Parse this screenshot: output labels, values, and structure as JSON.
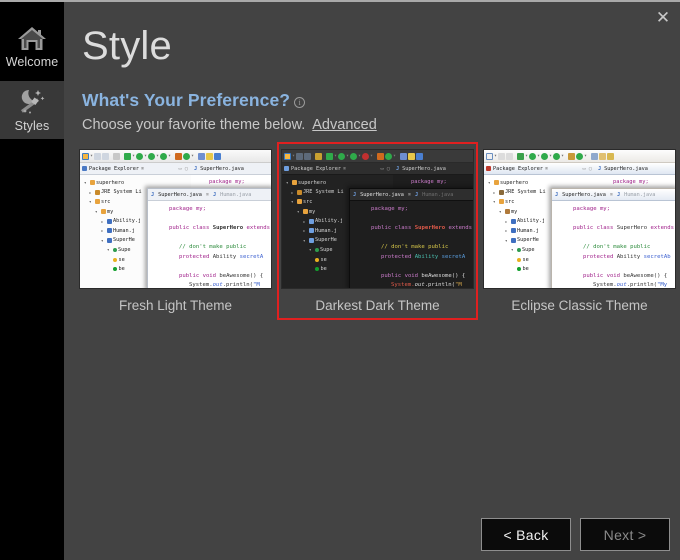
{
  "window": {
    "close_label": "✕"
  },
  "sidebar": {
    "items": [
      {
        "label": "Welcome",
        "icon": "home-icon",
        "selected": false
      },
      {
        "label": "Styles",
        "icon": "magic-wand-icon",
        "selected": true
      }
    ]
  },
  "header": {
    "title": "Style",
    "subheading": "What's Your Preference?",
    "info_icon": "i",
    "description": "Choose your favorite theme below.",
    "advanced_link": "Advanced"
  },
  "themes": {
    "selected_index": 1,
    "selection_color": "#e02020",
    "cards": [
      {
        "label": "Fresh Light Theme",
        "id": "fresh-light"
      },
      {
        "label": "Darkest Dark Theme",
        "id": "darkest-dark"
      },
      {
        "label": "Eclipse Classic Theme",
        "id": "eclipse-classic"
      }
    ]
  },
  "ide_mock": {
    "package_explorer_title": "Package Explorer",
    "tree": [
      "superhero",
      "JRE System Li",
      "src",
      "my",
      "Ability.j",
      "Human.j",
      "SuperHe",
      "Supe",
      "se",
      "be"
    ],
    "editor_tabs": [
      "SuperHero.java",
      "Human.java"
    ],
    "code_lines": [
      "package my;",
      "public class SuperHero extends",
      "// don't make public",
      "protected Ability secretAb",
      "public void beAwesome() {",
      "System.out.println(\"M",
      "}",
      "}"
    ],
    "right_tab": "SuperHero.java",
    "right_code": "package my;"
  },
  "footer": {
    "back_label": "< Back",
    "next_label": "Next >"
  }
}
